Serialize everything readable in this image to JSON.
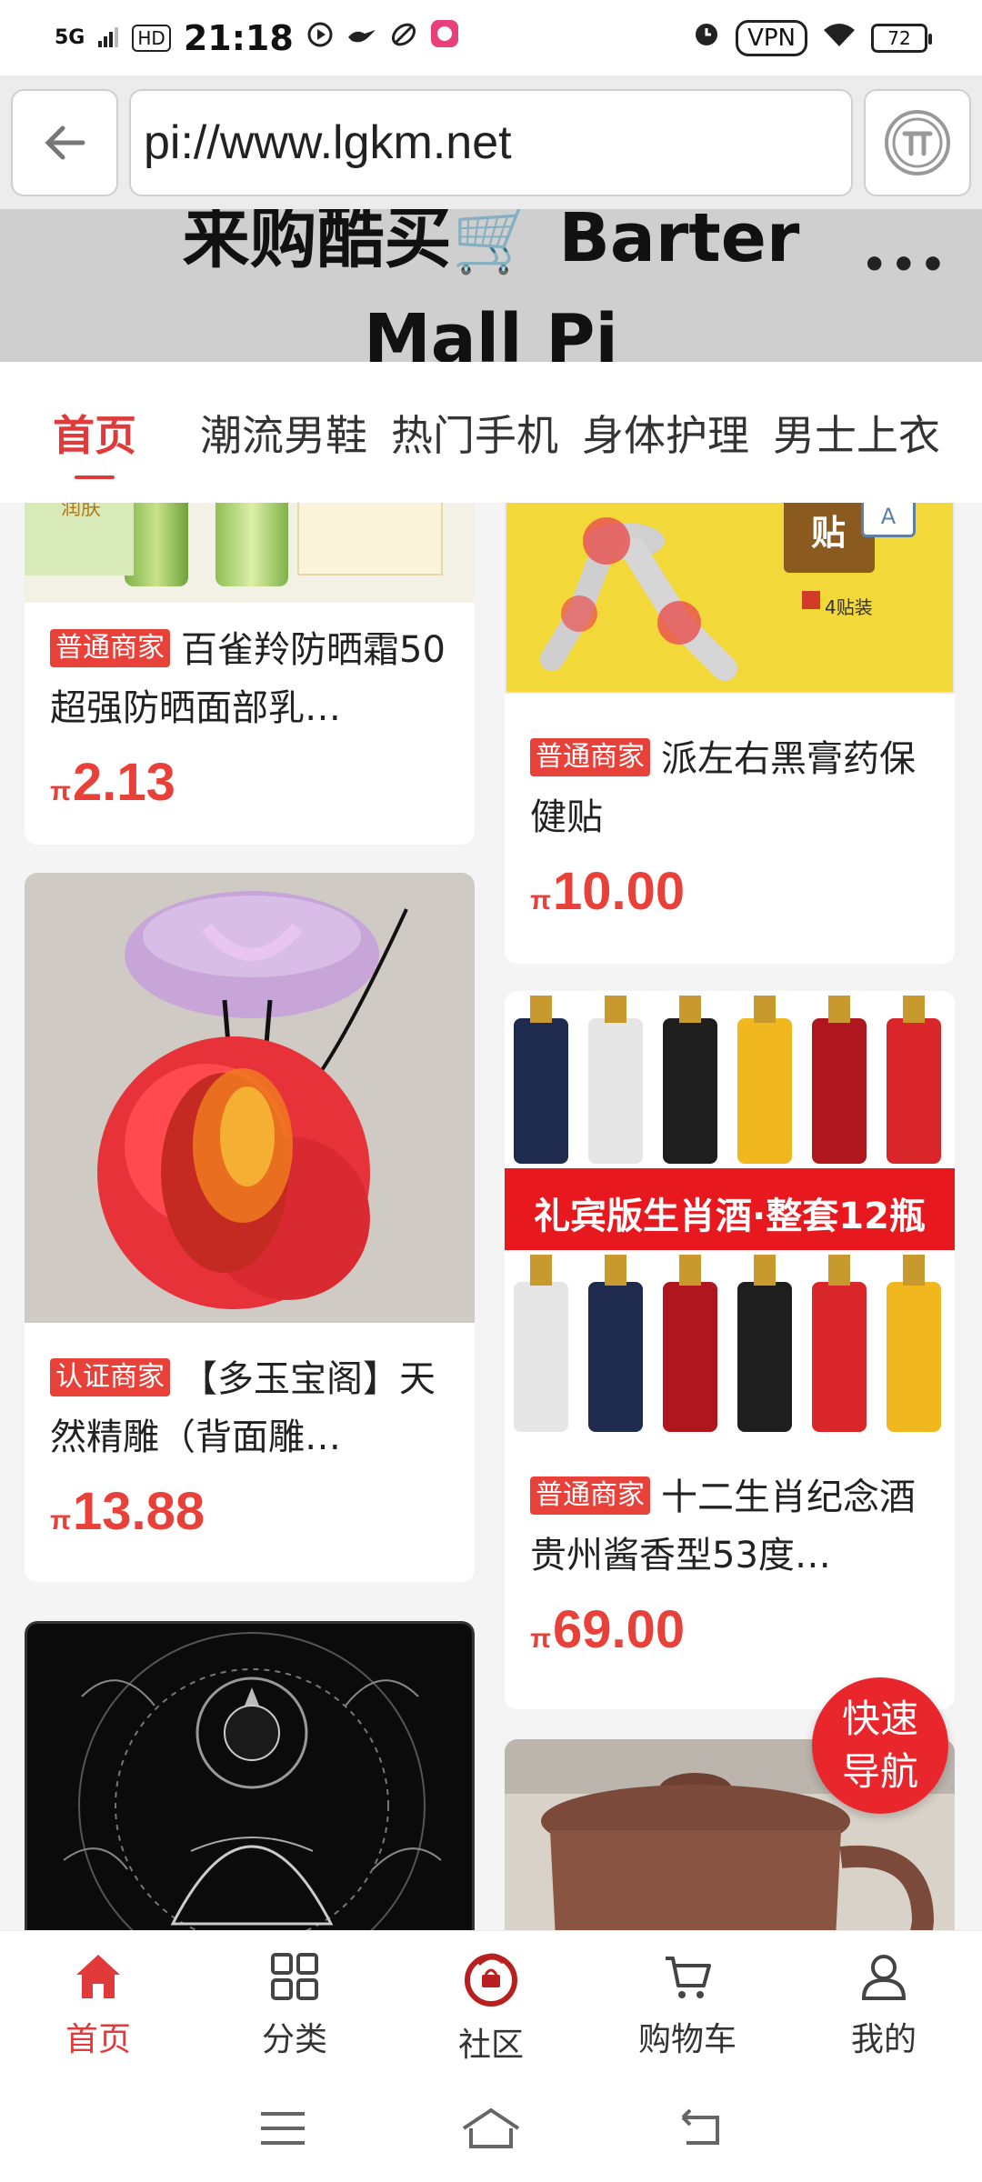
{
  "status_bar": {
    "network": "5G",
    "hd": "HD",
    "time": "21:18",
    "vpn": "VPN",
    "battery": "72"
  },
  "browser": {
    "url": "pi://www.lgkm.net"
  },
  "header": {
    "title_line1": "来购酷买🛒 Barter",
    "title_line2": "Mall Pi",
    "more": "•••"
  },
  "tabs": [
    "首页",
    "潮流男鞋",
    "热门手机",
    "身体护理",
    "男士上衣"
  ],
  "products": [
    {
      "badge": "普通商家",
      "title": "百雀羚防晒霜50超强防晒面部乳…",
      "price": "2.13",
      "currency": "π",
      "image_text": "润肤"
    },
    {
      "badge": "普通商家",
      "title": "派左右黑膏药保健贴",
      "price": "10.00",
      "currency": "π",
      "image_text": "4贴装",
      "image_text2": "贴"
    },
    {
      "badge": "认证商家",
      "title": "【多玉宝阁】天然精雕（背面雕…",
      "price": "13.88",
      "currency": "π"
    },
    {
      "badge": "普通商家",
      "title": "十二生肖纪念酒贵州酱香型53度…",
      "price": "69.00",
      "currency": "π",
      "image_text": "礼宾版生肖酒·整套12瓶"
    }
  ],
  "fab": {
    "line1": "快速",
    "line2": "导航"
  },
  "bottom_nav": [
    "首页",
    "分类",
    "社区",
    "购物车",
    "我的"
  ],
  "colors": {
    "accent": "#e8413a",
    "header_bg": "#cfcfcf",
    "browser_bg": "#ececec"
  }
}
